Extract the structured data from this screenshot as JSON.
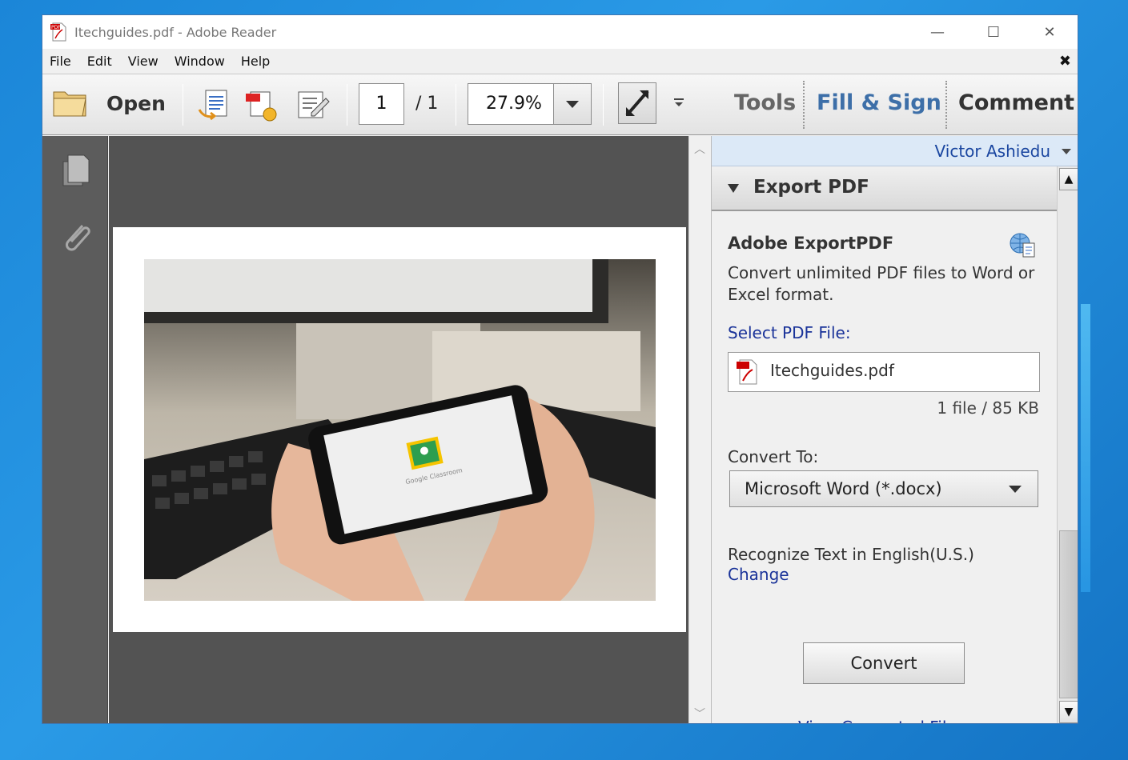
{
  "window": {
    "title": "Itechguides.pdf - Adobe Reader",
    "controls": {
      "minimize": "—",
      "maximize": "☐",
      "close": "✕"
    }
  },
  "menu": {
    "items": [
      "File",
      "Edit",
      "View",
      "Window",
      "Help"
    ],
    "close_doc": "✖"
  },
  "toolbar": {
    "open_label": "Open",
    "page_current": "1",
    "page_total_label": "/  1",
    "zoom": "27.9%",
    "right_tabs": [
      "Tools",
      "Fill & Sign",
      "Comment"
    ]
  },
  "right_pane": {
    "user_name": "Victor Ashiedu",
    "panel_title": "Export PDF",
    "heading": "Adobe ExportPDF",
    "description": "Convert unlimited PDF files to Word or Excel format.",
    "select_label": "Select PDF File:",
    "file_name": "Itechguides.pdf",
    "file_size": "1 file / 85 KB",
    "convert_to_label": "Convert To:",
    "convert_to_value": "Microsoft Word (*.docx)",
    "ocr_text": "Recognize Text in English(U.S.)",
    "change_link": "Change",
    "convert_button": "Convert",
    "view_converted_link": "View Converted Files"
  },
  "document": {
    "image_caption": "Google Classroom"
  },
  "colors": {
    "accent_blue": "#1a3399",
    "fill_sign": "#3d6fa8",
    "doc_bg": "#535353",
    "rail_bg": "#5c5c5c"
  },
  "icons": {
    "app": "pdf-file-icon",
    "open": "folder-open-icon",
    "rail": [
      "pages-icon",
      "attachment-icon"
    ],
    "panel": "globe-document-icon"
  }
}
